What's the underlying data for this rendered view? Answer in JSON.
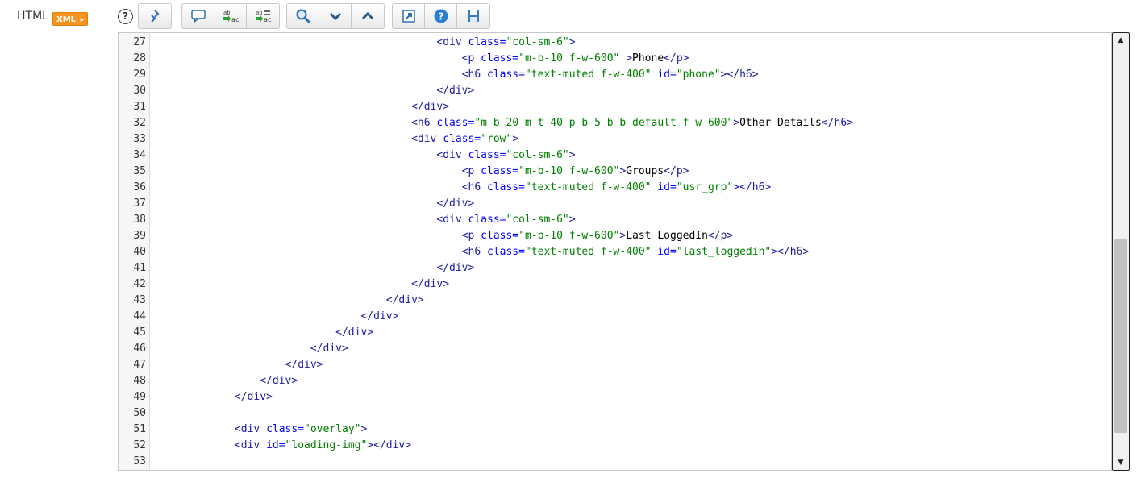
{
  "header": {
    "label": "HTML",
    "badge": "XML"
  },
  "toolbar": {
    "help": "?",
    "groups": [
      [
        "format-icon"
      ],
      [
        "comment-icon",
        "replace-icon",
        "replace-all-icon"
      ],
      [
        "search-icon",
        "find-next-icon",
        "find-previous-icon"
      ],
      [
        "expand-icon",
        "help-icon",
        "save-icon"
      ]
    ]
  },
  "editor": {
    "lines": [
      {
        "n": "27",
        "parts": [
          [
            "s",
            "                                            "
          ],
          [
            "t",
            "<div "
          ],
          [
            "a",
            "class="
          ],
          [
            "v",
            "\"col-sm-6\""
          ],
          [
            "t",
            ">"
          ]
        ]
      },
      {
        "n": "28",
        "parts": [
          [
            "s",
            "                                                "
          ],
          [
            "t",
            "<p "
          ],
          [
            "a",
            "class="
          ],
          [
            "v",
            "\"m-b-10 f-w-600\""
          ],
          [
            "t",
            " >"
          ],
          [
            "x",
            "Phone"
          ],
          [
            "t",
            "</p>"
          ]
        ]
      },
      {
        "n": "29",
        "parts": [
          [
            "s",
            "                                                "
          ],
          [
            "t",
            "<h6 "
          ],
          [
            "a",
            "class="
          ],
          [
            "v",
            "\"text-muted f-w-400\""
          ],
          [
            "a",
            " id="
          ],
          [
            "v",
            "\"phone\""
          ],
          [
            "t",
            "></h6>"
          ]
        ]
      },
      {
        "n": "30",
        "parts": [
          [
            "s",
            "                                            "
          ],
          [
            "t",
            "</div>"
          ]
        ]
      },
      {
        "n": "31",
        "parts": [
          [
            "s",
            "                                        "
          ],
          [
            "t",
            "</div>"
          ]
        ]
      },
      {
        "n": "32",
        "parts": [
          [
            "s",
            "                                        "
          ],
          [
            "t",
            "<h6 "
          ],
          [
            "a",
            "class="
          ],
          [
            "v",
            "\"m-b-20 m-t-40 p-b-5 b-b-default f-w-600\""
          ],
          [
            "t",
            ">"
          ],
          [
            "x",
            "Other Details"
          ],
          [
            "t",
            "</h6>"
          ]
        ]
      },
      {
        "n": "33",
        "parts": [
          [
            "s",
            "                                        "
          ],
          [
            "t",
            "<div "
          ],
          [
            "a",
            "class="
          ],
          [
            "v",
            "\"row\""
          ],
          [
            "t",
            ">"
          ]
        ]
      },
      {
        "n": "34",
        "parts": [
          [
            "s",
            "                                            "
          ],
          [
            "t",
            "<div "
          ],
          [
            "a",
            "class="
          ],
          [
            "v",
            "\"col-sm-6\""
          ],
          [
            "t",
            ">"
          ]
        ]
      },
      {
        "n": "35",
        "parts": [
          [
            "s",
            "                                                "
          ],
          [
            "t",
            "<p "
          ],
          [
            "a",
            "class="
          ],
          [
            "v",
            "\"m-b-10 f-w-600\""
          ],
          [
            "t",
            ">"
          ],
          [
            "x",
            "Groups"
          ],
          [
            "t",
            "</p>"
          ]
        ]
      },
      {
        "n": "36",
        "parts": [
          [
            "s",
            "                                                "
          ],
          [
            "t",
            "<h6 "
          ],
          [
            "a",
            "class="
          ],
          [
            "v",
            "\"text-muted f-w-400\""
          ],
          [
            "a",
            " id="
          ],
          [
            "v",
            "\"usr_grp\""
          ],
          [
            "t",
            "></h6>"
          ]
        ]
      },
      {
        "n": "37",
        "parts": [
          [
            "s",
            "                                            "
          ],
          [
            "t",
            "</div>"
          ]
        ]
      },
      {
        "n": "38",
        "parts": [
          [
            "s",
            "                                            "
          ],
          [
            "t",
            "<div "
          ],
          [
            "a",
            "class="
          ],
          [
            "v",
            "\"col-sm-6\""
          ],
          [
            "t",
            ">"
          ]
        ]
      },
      {
        "n": "39",
        "parts": [
          [
            "s",
            "                                                "
          ],
          [
            "t",
            "<p "
          ],
          [
            "a",
            "class="
          ],
          [
            "v",
            "\"m-b-10 f-w-600\""
          ],
          [
            "t",
            ">"
          ],
          [
            "x",
            "Last LoggedIn"
          ],
          [
            "t",
            "</p>"
          ]
        ]
      },
      {
        "n": "40",
        "parts": [
          [
            "s",
            "                                                "
          ],
          [
            "t",
            "<h6 "
          ],
          [
            "a",
            "class="
          ],
          [
            "v",
            "\"text-muted f-w-400\""
          ],
          [
            "a",
            " id="
          ],
          [
            "v",
            "\"last_loggedin\""
          ],
          [
            "t",
            "></h6>"
          ]
        ]
      },
      {
        "n": "41",
        "parts": [
          [
            "s",
            "                                            "
          ],
          [
            "t",
            "</div>"
          ]
        ]
      },
      {
        "n": "42",
        "parts": [
          [
            "s",
            "                                        "
          ],
          [
            "t",
            "</div>"
          ]
        ]
      },
      {
        "n": "43",
        "parts": [
          [
            "s",
            "                                    "
          ],
          [
            "t",
            "</div>"
          ]
        ]
      },
      {
        "n": "44",
        "parts": [
          [
            "s",
            "                                "
          ],
          [
            "t",
            "</div>"
          ]
        ]
      },
      {
        "n": "45",
        "parts": [
          [
            "s",
            "                            "
          ],
          [
            "t",
            "</div>"
          ]
        ]
      },
      {
        "n": "46",
        "parts": [
          [
            "s",
            "                        "
          ],
          [
            "t",
            "</div>"
          ]
        ]
      },
      {
        "n": "47",
        "parts": [
          [
            "s",
            "                    "
          ],
          [
            "t",
            "</div>"
          ]
        ]
      },
      {
        "n": "48",
        "parts": [
          [
            "s",
            "                "
          ],
          [
            "t",
            "</div>"
          ]
        ]
      },
      {
        "n": "49",
        "parts": [
          [
            "s",
            "            "
          ],
          [
            "t",
            "</div>"
          ]
        ]
      },
      {
        "n": "50",
        "parts": []
      },
      {
        "n": "51",
        "parts": [
          [
            "s",
            "            "
          ],
          [
            "t",
            "<div "
          ],
          [
            "a",
            "class="
          ],
          [
            "v",
            "\"overlay\""
          ],
          [
            "t",
            ">"
          ]
        ]
      },
      {
        "n": "52",
        "parts": [
          [
            "s",
            "            "
          ],
          [
            "t",
            "<div "
          ],
          [
            "a",
            "id="
          ],
          [
            "v",
            "\"loading-img\""
          ],
          [
            "t",
            "></div>"
          ]
        ]
      },
      {
        "n": "53",
        "parts": []
      }
    ]
  },
  "colors": {
    "tag": "#1a1aa6",
    "attr": "#0000ff",
    "value": "#008000",
    "text": "#000000",
    "badge": "#f7941d"
  }
}
